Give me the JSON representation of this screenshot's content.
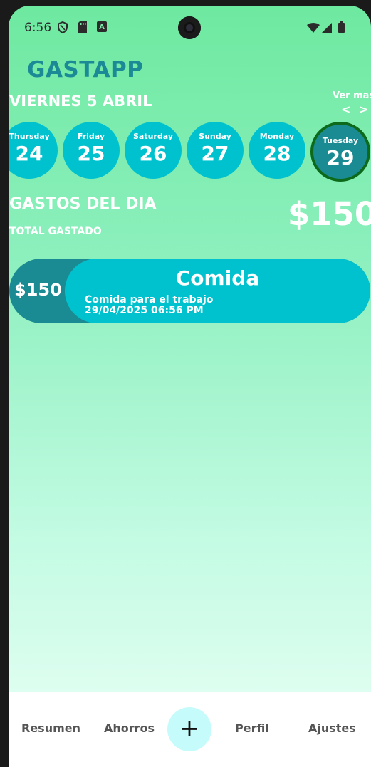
{
  "status": {
    "time": "6:56"
  },
  "app": {
    "title": "GASTAPP"
  },
  "date_header": {
    "label": "VIERNES 5 ABRIL",
    "ver_mas": "Ver mas",
    "arrows": "< >"
  },
  "days": [
    {
      "name": "Thursday",
      "num": "24",
      "selected": false
    },
    {
      "name": "Friday",
      "num": "25",
      "selected": false
    },
    {
      "name": "Saturday",
      "num": "26",
      "selected": false
    },
    {
      "name": "Sunday",
      "num": "27",
      "selected": false
    },
    {
      "name": "Monday",
      "num": "28",
      "selected": false
    },
    {
      "name": "Tuesday",
      "num": "29",
      "selected": true
    }
  ],
  "summary": {
    "title": "GASTOS DEL DIA",
    "total_label": "TOTAL GASTADO",
    "total_value": "$150"
  },
  "expenses": [
    {
      "amount": "$150",
      "category": "Comida",
      "description": "Comida para el trabajo",
      "datetime": "29/04/2025 06:56 PM"
    }
  ],
  "nav": {
    "resumen": "Resumen",
    "ahorros": "Ahorros",
    "add": "+",
    "perfil": "Perfil",
    "ajustes": "Ajustes"
  },
  "colors": {
    "accent": "#00c2cf",
    "dark_accent": "#1a8a93",
    "title": "#1b8a96",
    "selected_border": "#0c6a1a"
  },
  "icons": [
    "shield-icon",
    "sd-card-icon",
    "text-a-icon",
    "wifi-icon",
    "signal-icon",
    "battery-icon",
    "plus-icon"
  ]
}
